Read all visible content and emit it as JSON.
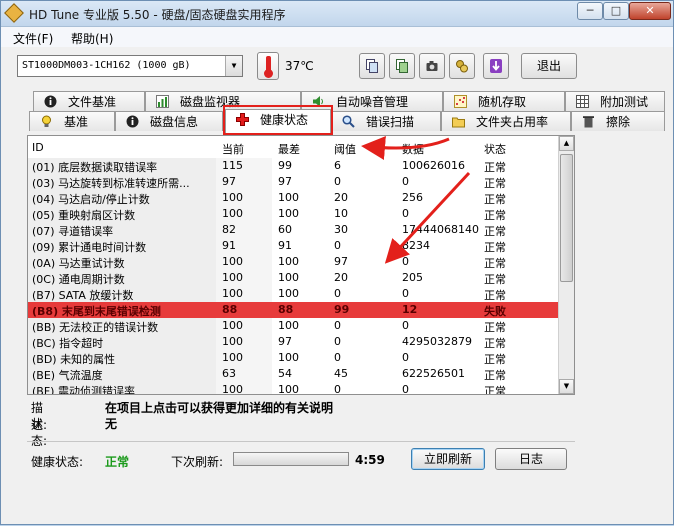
{
  "window": {
    "title": "HD Tune 专业版 5.50 - 硬盘/固态硬盘实用程序",
    "minimize": "─",
    "maximize": "□",
    "close": "✕"
  },
  "menu": {
    "file": "文件(F)",
    "help": "帮助(H)"
  },
  "toolbar": {
    "drive": "ST1000DM003-1CH162 (1000 gB)",
    "temperature": "37℃",
    "exit_label": "退出",
    "icons": [
      "copy-icon",
      "save-icon",
      "camera-icon",
      "options-icon",
      "download-icon"
    ]
  },
  "tabs": {
    "row1": [
      "文件基准",
      "磁盘监视器",
      "自动噪音管理",
      "随机存取",
      "附加测试"
    ],
    "row2": [
      "基准",
      "磁盘信息",
      "健康状态",
      "错误扫描",
      "文件夹占用率",
      "擦除"
    ],
    "active": "健康状态"
  },
  "table": {
    "headers": [
      "ID",
      "当前",
      "最差",
      "阈值",
      "数据",
      "状态"
    ],
    "rows": [
      [
        "(01) 底层数据读取错误率",
        "115",
        "99",
        "6",
        "100626016",
        "正常"
      ],
      [
        "(03) 马达旋转到标准转速所需...",
        "97",
        "97",
        "0",
        "0",
        "正常"
      ],
      [
        "(04) 马达启动/停止计数",
        "100",
        "100",
        "20",
        "256",
        "正常"
      ],
      [
        "(05) 重映射扇区计数",
        "100",
        "100",
        "10",
        "0",
        "正常"
      ],
      [
        "(07) 寻道错误率",
        "82",
        "60",
        "30",
        "17444068140",
        "正常"
      ],
      [
        "(09) 累计通电时间计数",
        "91",
        "91",
        "0",
        "8234",
        "正常"
      ],
      [
        "(0A) 马达重试计数",
        "100",
        "100",
        "97",
        "0",
        "正常"
      ],
      [
        "(0C) 通电周期计数",
        "100",
        "100",
        "20",
        "205",
        "正常"
      ],
      [
        "(B7) SATA 放缓计数",
        "100",
        "100",
        "0",
        "0",
        "正常"
      ],
      [
        "(B8) 末尾到末尾错误检测",
        "88",
        "88",
        "99",
        "12",
        "失败"
      ],
      [
        "(BB) 无法校正的错误计数",
        "100",
        "100",
        "0",
        "0",
        "正常"
      ],
      [
        "(BC) 指令超时",
        "100",
        "97",
        "0",
        "4295032879",
        "正常"
      ],
      [
        "(BD) 未知的属性",
        "100",
        "100",
        "0",
        "0",
        "正常"
      ],
      [
        "(BE) 气流温度",
        "63",
        "54",
        "45",
        "622526501",
        "正常"
      ],
      [
        "(BF) 震动侦测错误率",
        "100",
        "100",
        "0",
        "0",
        "正常"
      ]
    ],
    "failed_row_index": 9
  },
  "details": {
    "desc_label": "描述:",
    "desc_value": "在项目上点击可以获得更加详细的有关说明",
    "status_label": "状态:",
    "status_value": "无"
  },
  "footer": {
    "health_label": "健康状态:",
    "health_value": "正常",
    "next_refresh_label": "下次刷新:",
    "countdown": "4:59",
    "refresh_progress": 0.0,
    "refresh_button": "立即刷新",
    "log_button": "日志"
  },
  "colors": {
    "failed_row": "#e73b3b",
    "healthy": "#1b9a1b",
    "annotation": "#e3201b"
  }
}
